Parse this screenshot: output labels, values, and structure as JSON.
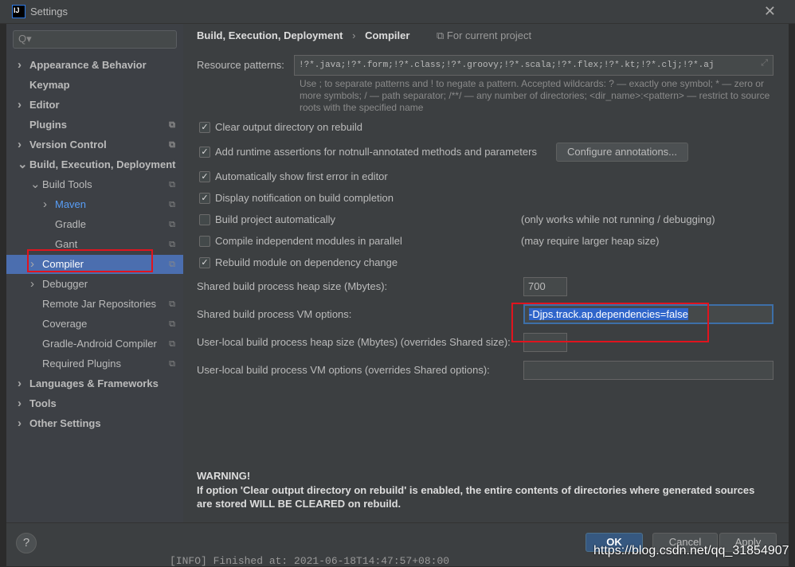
{
  "window": {
    "title": "Settings",
    "logo": "IJ"
  },
  "search": {
    "placeholder": "Q▾"
  },
  "sidebar": {
    "items": [
      {
        "label": "Appearance & Behavior"
      },
      {
        "label": "Keymap"
      },
      {
        "label": "Editor"
      },
      {
        "label": "Plugins"
      },
      {
        "label": "Version Control"
      },
      {
        "label": "Build, Execution, Deployment"
      },
      {
        "label": "Build Tools"
      },
      {
        "label": "Maven"
      },
      {
        "label": "Gradle"
      },
      {
        "label": "Gant"
      },
      {
        "label": "Compiler"
      },
      {
        "label": "Debugger"
      },
      {
        "label": "Remote Jar Repositories"
      },
      {
        "label": "Coverage"
      },
      {
        "label": "Gradle-Android Compiler"
      },
      {
        "label": "Required Plugins"
      },
      {
        "label": "Languages & Frameworks"
      },
      {
        "label": "Tools"
      },
      {
        "label": "Other Settings"
      }
    ]
  },
  "main": {
    "breadcrumb": {
      "parent": "Build, Execution, Deployment",
      "current": "Compiler",
      "scope": "For current project"
    },
    "resource_label": "Resource patterns:",
    "resource_value": "!?*.java;!?*.form;!?*.class;!?*.groovy;!?*.scala;!?*.flex;!?*.kt;!?*.clj;!?*.aj",
    "hint": "Use ; to separate patterns and ! to negate a pattern. Accepted wildcards: ? — exactly one symbol; * — zero or more symbols; / — path separator; /**/ — any number of directories; <dir_name>:<pattern> — restrict to source roots with the specified name",
    "checkboxes": [
      {
        "label": "Clear output directory on rebuild",
        "checked": true
      },
      {
        "label": "Add runtime assertions for notnull-annotated methods and parameters",
        "checked": true
      },
      {
        "label": "Automatically show first error in editor",
        "checked": true
      },
      {
        "label": "Display notification on build completion",
        "checked": true
      },
      {
        "label": "Build project automatically",
        "checked": false,
        "note": "(only works while not running / debugging)"
      },
      {
        "label": "Compile independent modules in parallel",
        "checked": false,
        "note": "(may require larger heap size)"
      },
      {
        "label": "Rebuild module on dependency change",
        "checked": true
      }
    ],
    "configure_annotations": "Configure annotations...",
    "heap_label": "Shared build process heap size (Mbytes):",
    "heap_value": "700",
    "vm_label": "Shared build process VM options:",
    "vm_value": "-Djps.track.ap.dependencies=false",
    "user_heap_label": "User-local build process heap size (Mbytes) (overrides Shared size):",
    "user_heap_value": "",
    "user_vm_label": "User-local build process VM options (overrides Shared options):",
    "user_vm_value": "",
    "warning_title": "WARNING!",
    "warning_text": "If option 'Clear output directory on rebuild' is enabled, the entire contents of directories where generated sources are stored WILL BE CLEARED on rebuild."
  },
  "footer": {
    "help": "?",
    "ok": "OK",
    "cancel": "Cancel",
    "apply": "Apply"
  },
  "watermark": "https://blog.csdn.net/qq_31854907",
  "background_log": "[INFO] Finished at: 2021-06-18T14:47:57+08:00",
  "colors": {
    "selection": "#4b6eaf",
    "highlight_box": "#e0141e",
    "ok_button": "#365880"
  }
}
